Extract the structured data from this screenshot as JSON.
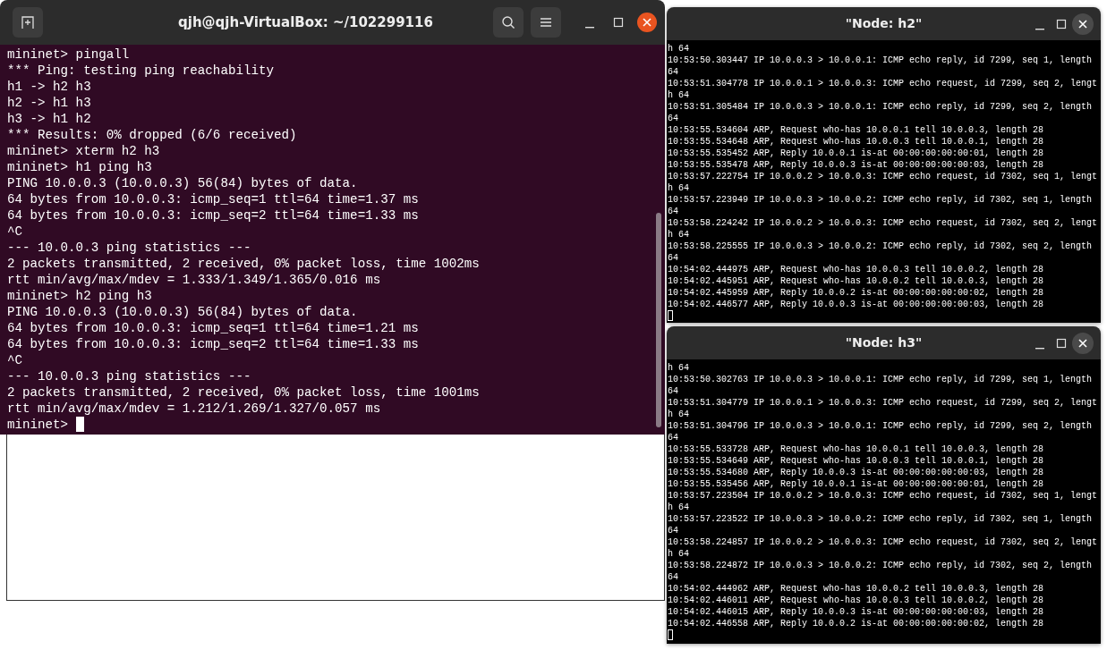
{
  "terminal": {
    "title": "qjh@qjh-VirtualBox: ~/102299116",
    "lines": [
      "mininet> pingall",
      "*** Ping: testing ping reachability",
      "h1 -> h2 h3",
      "h2 -> h1 h3",
      "h3 -> h1 h2",
      "*** Results: 0% dropped (6/6 received)",
      "mininet> xterm h2 h3",
      "mininet> h1 ping h3",
      "PING 10.0.0.3 (10.0.0.3) 56(84) bytes of data.",
      "64 bytes from 10.0.0.3: icmp_seq=1 ttl=64 time=1.37 ms",
      "64 bytes from 10.0.0.3: icmp_seq=2 ttl=64 time=1.33 ms",
      "^C",
      "--- 10.0.0.3 ping statistics ---",
      "2 packets transmitted, 2 received, 0% packet loss, time 1002ms",
      "rtt min/avg/max/mdev = 1.333/1.349/1.365/0.016 ms",
      "mininet> h2 ping h3",
      "PING 10.0.0.3 (10.0.0.3) 56(84) bytes of data.",
      "64 bytes from 10.0.0.3: icmp_seq=1 ttl=64 time=1.21 ms",
      "64 bytes from 10.0.0.3: icmp_seq=2 ttl=64 time=1.33 ms",
      "^C",
      "--- 10.0.0.3 ping statistics ---",
      "2 packets transmitted, 2 received, 0% packet loss, time 1001ms",
      "rtt min/avg/max/mdev = 1.212/1.269/1.327/0.057 ms",
      "mininet> "
    ]
  },
  "xterms": [
    {
      "title": "\"Node: h2\"",
      "lines": [
        "h 64",
        "10:53:50.303447 IP 10.0.0.3 > 10.0.0.1: ICMP echo reply, id 7299, seq 1, length",
        "64",
        "10:53:51.304778 IP 10.0.0.1 > 10.0.0.3: ICMP echo request, id 7299, seq 2, lengt",
        "h 64",
        "10:53:51.305484 IP 10.0.0.3 > 10.0.0.1: ICMP echo reply, id 7299, seq 2, length",
        "64",
        "10:53:55.534604 ARP, Request who-has 10.0.0.1 tell 10.0.0.3, length 28",
        "10:53:55.534648 ARP, Request who-has 10.0.0.3 tell 10.0.0.1, length 28",
        "10:53:55.535452 ARP, Reply 10.0.0.1 is-at 00:00:00:00:00:01, length 28",
        "10:53:55.535478 ARP, Reply 10.0.0.3 is-at 00:00:00:00:00:03, length 28",
        "10:53:57.222754 IP 10.0.0.2 > 10.0.0.3: ICMP echo request, id 7302, seq 1, lengt",
        "h 64",
        "10:53:57.223949 IP 10.0.0.3 > 10.0.0.2: ICMP echo reply, id 7302, seq 1, length",
        "64",
        "10:53:58.224242 IP 10.0.0.2 > 10.0.0.3: ICMP echo request, id 7302, seq 2, lengt",
        "h 64",
        "10:53:58.225555 IP 10.0.0.3 > 10.0.0.2: ICMP echo reply, id 7302, seq 2, length",
        "64",
        "10:54:02.444975 ARP, Request who-has 10.0.0.3 tell 10.0.0.2, length 28",
        "10:54:02.445951 ARP, Request who-has 10.0.0.2 tell 10.0.0.3, length 28",
        "10:54:02.445959 ARP, Reply 10.0.0.2 is-at 00:00:00:00:00:02, length 28",
        "10:54:02.446577 ARP, Reply 10.0.0.3 is-at 00:00:00:00:00:03, length 28"
      ]
    },
    {
      "title": "\"Node: h3\"",
      "lines": [
        "h 64",
        "10:53:50.302763 IP 10.0.0.3 > 10.0.0.1: ICMP echo reply, id 7299, seq 1, length",
        "64",
        "10:53:51.304779 IP 10.0.0.1 > 10.0.0.3: ICMP echo request, id 7299, seq 2, lengt",
        "h 64",
        "10:53:51.304796 IP 10.0.0.3 > 10.0.0.1: ICMP echo reply, id 7299, seq 2, length",
        "64",
        "10:53:55.533728 ARP, Request who-has 10.0.0.1 tell 10.0.0.3, length 28",
        "10:53:55.534649 ARP, Request who-has 10.0.0.3 tell 10.0.0.1, length 28",
        "10:53:55.534680 ARP, Reply 10.0.0.3 is-at 00:00:00:00:00:03, length 28",
        "10:53:55.535456 ARP, Reply 10.0.0.1 is-at 00:00:00:00:00:01, length 28",
        "10:53:57.223504 IP 10.0.0.2 > 10.0.0.3: ICMP echo request, id 7302, seq 1, lengt",
        "h 64",
        "10:53:57.223522 IP 10.0.0.3 > 10.0.0.2: ICMP echo reply, id 7302, seq 1, length",
        "64",
        "10:53:58.224857 IP 10.0.0.2 > 10.0.0.3: ICMP echo request, id 7302, seq 2, lengt",
        "h 64",
        "10:53:58.224872 IP 10.0.0.3 > 10.0.0.2: ICMP echo reply, id 7302, seq 2, length",
        "64",
        "10:54:02.444962 ARP, Request who-has 10.0.0.2 tell 10.0.0.3, length 28",
        "10:54:02.446011 ARP, Request who-has 10.0.0.3 tell 10.0.0.2, length 28",
        "10:54:02.446015 ARP, Reply 10.0.0.3 is-at 00:00:00:00:00:03, length 28",
        "10:54:02.446558 ARP, Reply 10.0.0.2 is-at 00:00:00:00:00:02, length 28"
      ]
    }
  ]
}
